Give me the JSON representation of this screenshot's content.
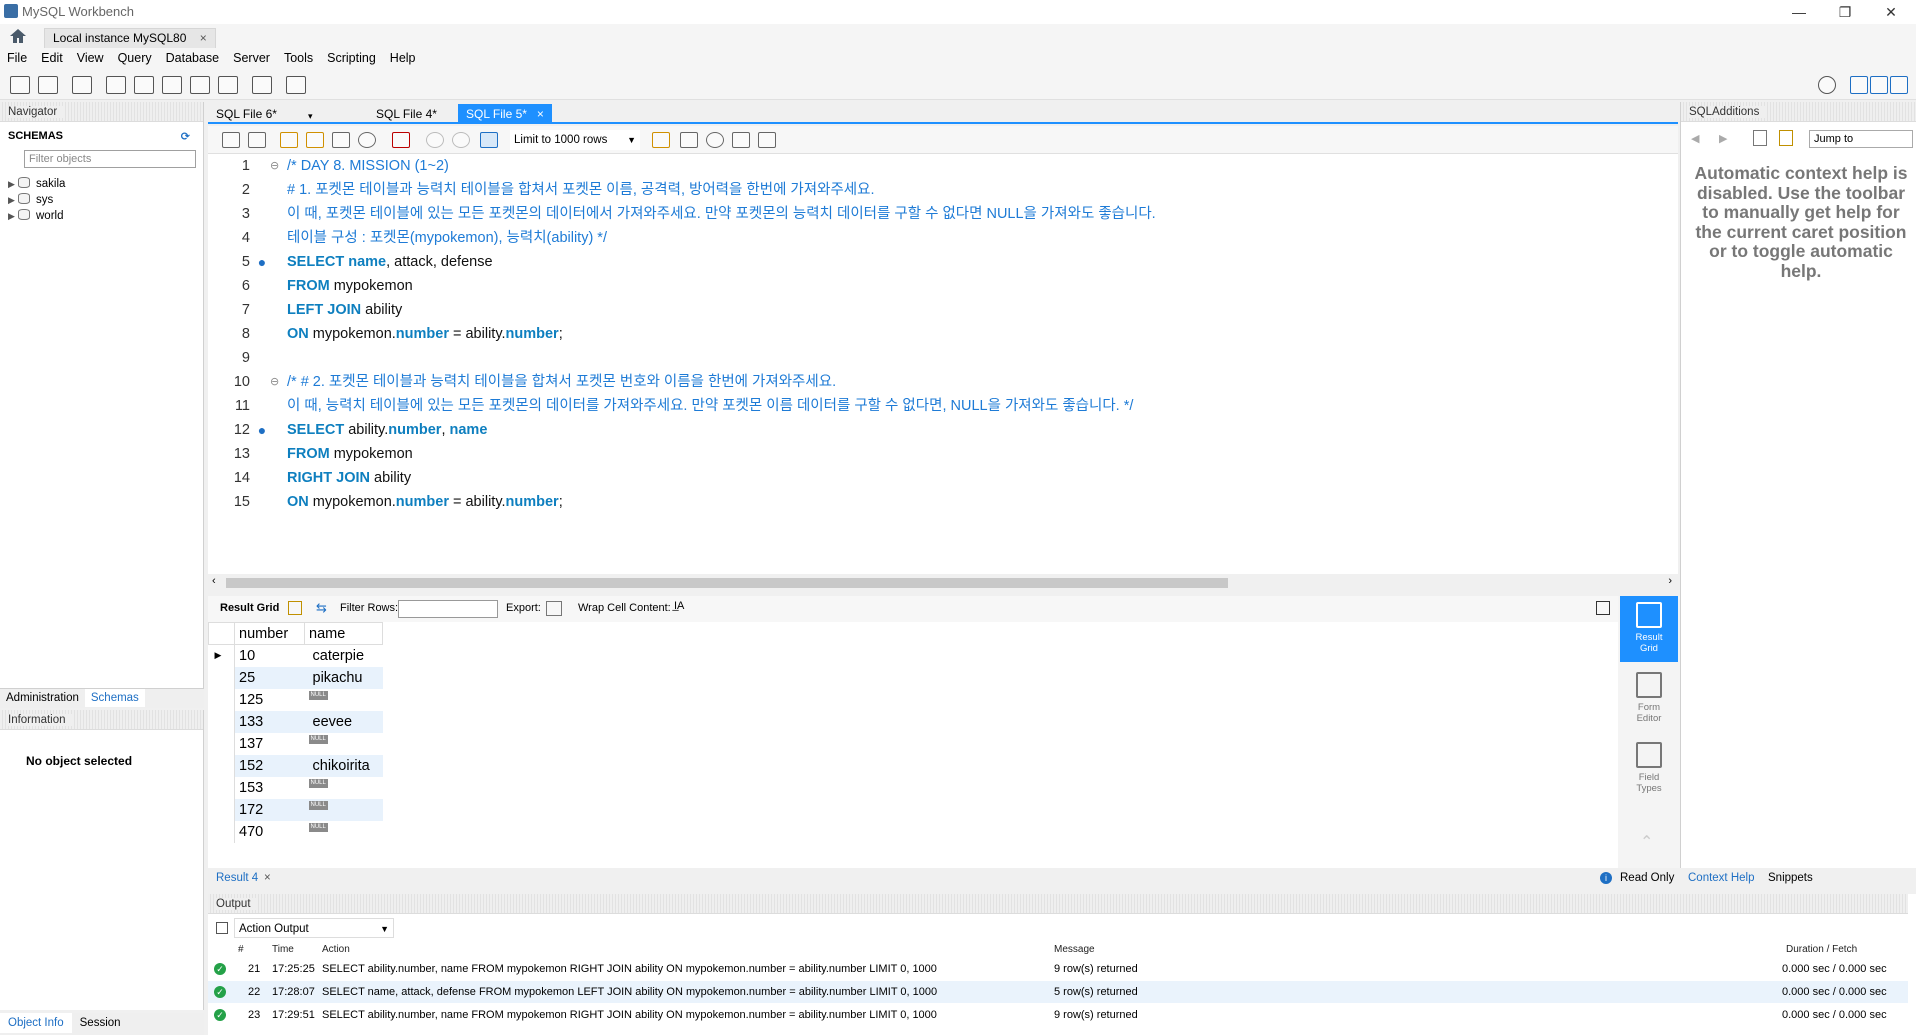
{
  "window": {
    "title": "MySQL Workbench",
    "min": "—",
    "max": "❐",
    "close": "✕"
  },
  "conn_tab": {
    "label": "Local instance MySQL80",
    "close": "×"
  },
  "menu": [
    "File",
    "Edit",
    "View",
    "Query",
    "Database",
    "Server",
    "Tools",
    "Scripting",
    "Help"
  ],
  "navigator": {
    "title": "Navigator",
    "schemas_label": "SCHEMAS",
    "filter_placeholder": "Filter objects",
    "schemas": [
      "sakila",
      "sys",
      "world"
    ],
    "tabs": [
      "Administration",
      "Schemas"
    ],
    "info_title": "Information",
    "no_object": "No object selected",
    "bottom_tabs": [
      "Object Info",
      "Session"
    ]
  },
  "editor_tabs": [
    {
      "label": "SQL File 6*",
      "active": false
    },
    {
      "label": "SQL File 4*",
      "active": false
    },
    {
      "label": "SQL File 5*",
      "active": true
    }
  ],
  "editor_toolbar": {
    "limit": "Limit to 1000 rows"
  },
  "code_lines": [
    {
      "n": "1",
      "marker": "",
      "fold": "⊖",
      "parts": [
        [
          "cmt",
          "/* DAY 8. MISSION (1~2)"
        ]
      ]
    },
    {
      "n": "2",
      "marker": "",
      "fold": "",
      "parts": [
        [
          "cmt",
          "# 1. 포켓몬 테이블과 능력치 테이블을 합쳐서 포켓몬 이름, 공격력, 방어력을 한번에 가져와주세요."
        ]
      ]
    },
    {
      "n": "3",
      "marker": "",
      "fold": "",
      "parts": [
        [
          "cmt",
          "이 때, 포켓몬 테이블에 있는 모든 포켓몬의 데이터에서 가져와주세요. 만약 포켓몬의 능력치 데이터를 구할 수 없다면 NULL을 가져와도 좋습니다."
        ]
      ]
    },
    {
      "n": "4",
      "marker": "",
      "fold": "",
      "parts": [
        [
          "cmt",
          "테이블 구성 : 포켓몬(mypokemon), 능력치(ability) */"
        ]
      ]
    },
    {
      "n": "5",
      "marker": "●",
      "fold": "",
      "parts": [
        [
          "kw",
          "SELECT "
        ],
        [
          "col",
          "name"
        ],
        [
          "txt",
          ", attack, defense"
        ]
      ]
    },
    {
      "n": "6",
      "marker": "",
      "fold": "",
      "parts": [
        [
          "kw",
          "FROM "
        ],
        [
          "txt",
          "mypokemon"
        ]
      ]
    },
    {
      "n": "7",
      "marker": "",
      "fold": "",
      "parts": [
        [
          "kw",
          "LEFT JOIN "
        ],
        [
          "txt",
          "ability"
        ]
      ]
    },
    {
      "n": "8",
      "marker": "",
      "fold": "",
      "parts": [
        [
          "kw",
          "ON "
        ],
        [
          "txt",
          "mypokemon."
        ],
        [
          "col",
          "number"
        ],
        [
          "txt",
          " = ability."
        ],
        [
          "col",
          "number"
        ],
        [
          "txt",
          ";"
        ]
      ]
    },
    {
      "n": "9",
      "marker": "",
      "fold": "",
      "parts": []
    },
    {
      "n": "10",
      "marker": "",
      "fold": "⊖",
      "parts": [
        [
          "cmt",
          "/* # 2. 포켓몬 테이블과 능력치 테이블을 합쳐서 포켓몬 번호와 이름을 한번에 가져와주세요."
        ]
      ]
    },
    {
      "n": "11",
      "marker": "",
      "fold": "",
      "parts": [
        [
          "cmt",
          "이 때, 능력치 테이블에 있는 모든 포켓몬의 데이터를 가져와주세요. 만약 포켓몬 이름 데이터를 구할 수 없다면, NULL을 가져와도 좋습니다. */"
        ]
      ]
    },
    {
      "n": "12",
      "marker": "●",
      "fold": "",
      "parts": [
        [
          "kw",
          "SELECT "
        ],
        [
          "txt",
          "ability."
        ],
        [
          "col",
          "number"
        ],
        [
          "txt",
          ", "
        ],
        [
          "col",
          "name"
        ]
      ]
    },
    {
      "n": "13",
      "marker": "",
      "fold": "",
      "parts": [
        [
          "kw",
          "FROM "
        ],
        [
          "txt",
          "mypokemon"
        ]
      ]
    },
    {
      "n": "14",
      "marker": "",
      "fold": "",
      "parts": [
        [
          "kw",
          "RIGHT JOIN "
        ],
        [
          "txt",
          "ability"
        ]
      ]
    },
    {
      "n": "15",
      "marker": "",
      "fold": "",
      "parts": [
        [
          "kw",
          "ON "
        ],
        [
          "txt",
          "mypokemon."
        ],
        [
          "col",
          "number"
        ],
        [
          "txt",
          " = ability."
        ],
        [
          "col",
          "number"
        ],
        [
          "txt",
          ";"
        ]
      ]
    }
  ],
  "result_toolbar": {
    "grid_label": "Result Grid",
    "filter_label": "Filter Rows:",
    "export_label": "Export:",
    "wrap_label": "Wrap Cell Content:"
  },
  "result": {
    "columns": [
      "number",
      "name"
    ],
    "null_label": "NULL",
    "rows": [
      [
        "10",
        "caterpie"
      ],
      [
        "25",
        "pikachu"
      ],
      [
        "125",
        null
      ],
      [
        "133",
        "eevee"
      ],
      [
        "137",
        null
      ],
      [
        "152",
        "chikoirita"
      ],
      [
        "153",
        null
      ],
      [
        "172",
        null
      ],
      [
        "470",
        null
      ]
    ]
  },
  "result_side": [
    {
      "label1": "Result",
      "label2": "Grid",
      "active": true
    },
    {
      "label1": "Form",
      "label2": "Editor",
      "active": false
    },
    {
      "label1": "Field",
      "label2": "Types",
      "active": false
    }
  ],
  "result_tabs": {
    "tab": "Result 4",
    "close": "×",
    "read_only": "Read Only"
  },
  "output": {
    "title": "Output",
    "selector": "Action Output",
    "headers": [
      "#",
      "Time",
      "Action",
      "Message",
      "Duration / Fetch"
    ],
    "rows": [
      {
        "n": "21",
        "time": "17:25:25",
        "action": "SELECT ability.number, name FROM mypokemon RIGHT JOIN ability ON mypokemon.number = ability.number LIMIT 0, 1000",
        "message": "9 row(s) returned",
        "duration": "0.000 sec / 0.000 sec"
      },
      {
        "n": "22",
        "time": "17:28:07",
        "action": "SELECT name, attack, defense FROM mypokemon LEFT JOIN ability ON mypokemon.number = ability.number LIMIT 0, 1000",
        "message": "5 row(s) returned",
        "duration": "0.000 sec / 0.000 sec"
      },
      {
        "n": "23",
        "time": "17:29:51",
        "action": "SELECT ability.number, name FROM mypokemon RIGHT JOIN ability ON mypokemon.number = ability.number LIMIT 0, 1000",
        "message": "9 row(s) returned",
        "duration": "0.000 sec / 0.000 sec"
      }
    ]
  },
  "sql_additions": {
    "title": "SQLAdditions",
    "jump_to": "Jump to",
    "help_text": "Automatic context help is disabled. Use the toolbar to manually get help for the current caret position or to toggle automatic help.",
    "tabs": [
      "Context Help",
      "Snippets"
    ]
  },
  "colors": {
    "accent": "#1e90ff",
    "keyword": "#0e7fbf",
    "comment": "#1e7bd6",
    "ok": "#24a148"
  }
}
